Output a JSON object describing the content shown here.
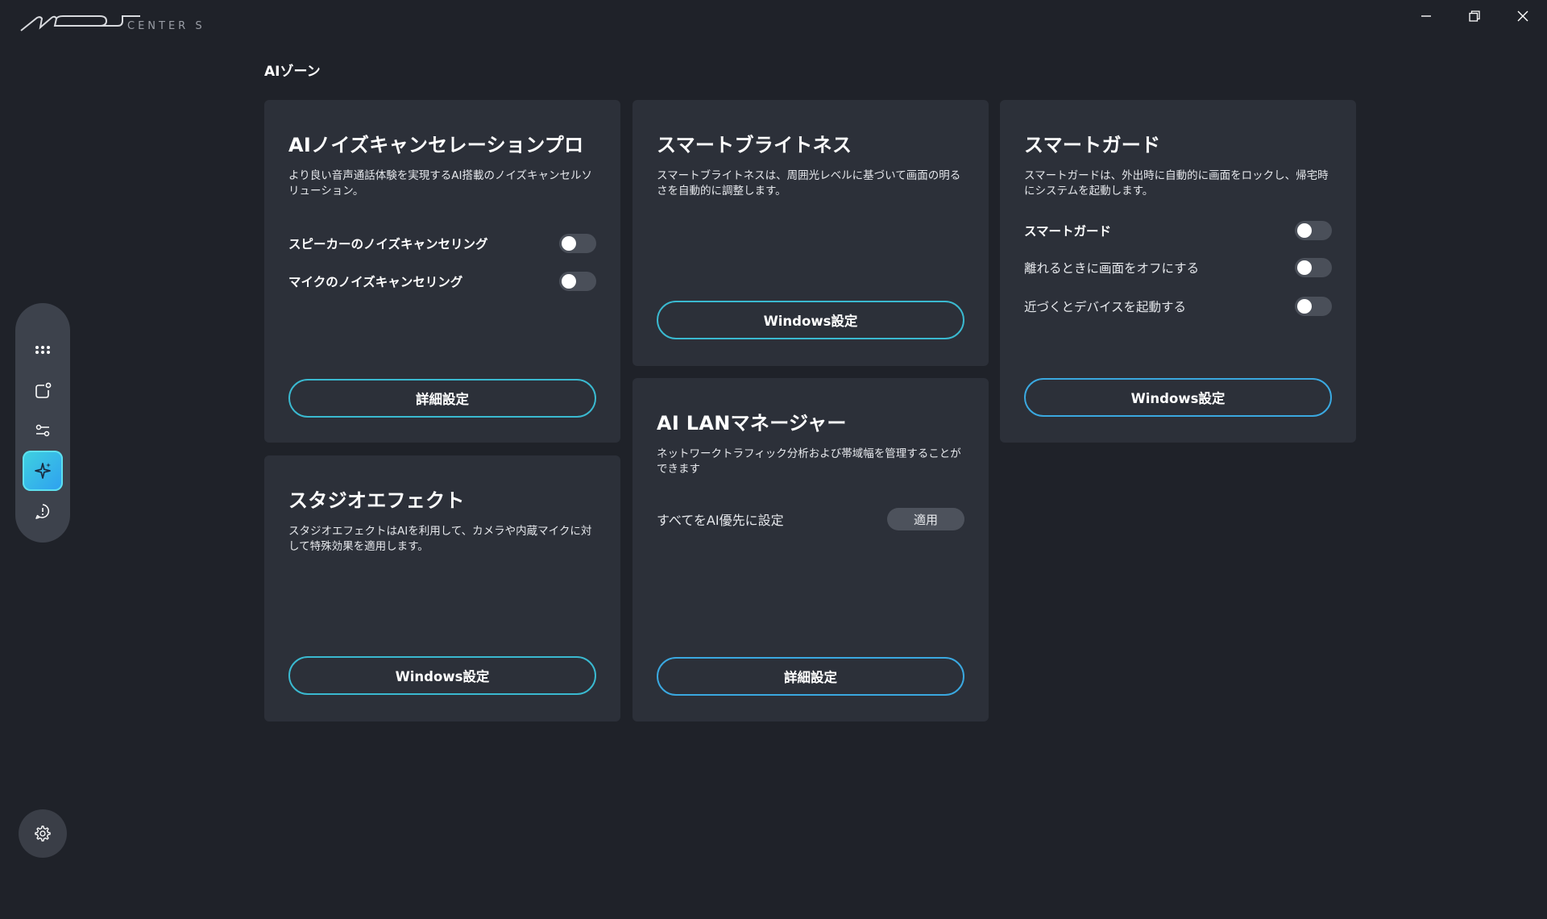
{
  "app": {
    "logo_text": "CENTER S"
  },
  "page": {
    "title": "AIゾーン"
  },
  "cards": {
    "noise": {
      "title": "AIノイズキャンセレーションプロ",
      "desc": "より良い音声通話体験を実現するAI搭載のノイズキャンセルソリューション。",
      "rows": [
        {
          "label": "スピーカーのノイズキャンセリング",
          "on": false
        },
        {
          "label": "マイクのノイズキャンセリング",
          "on": false
        }
      ],
      "button": "詳細設定"
    },
    "brightness": {
      "title": "スマートブライトネス",
      "desc": "スマートブライトネスは、周囲光レベルに基づいて画面の明るさを自動的に調整します。",
      "button": "Windows設定"
    },
    "guard": {
      "title": "スマートガード",
      "desc": "スマートガードは、外出時に自動的に画面をロックし、帰宅時にシステムを起動します。",
      "rows": [
        {
          "label": "スマートガード",
          "on": false
        },
        {
          "label": "離れるときに画面をオフにする",
          "on": false
        },
        {
          "label": "近づくとデバイスを起動する",
          "on": false
        }
      ],
      "button": "Windows設定"
    },
    "studio": {
      "title": "スタジオエフェクト",
      "desc": "スタジオエフェクトはAIを利用して、カメラや内蔵マイクに対して特殊効果を適用します。",
      "button": "Windows設定"
    },
    "lan": {
      "title": "AI LANマネージャー",
      "desc": "ネットワークトラフィック分析および帯域幅を管理することができます",
      "row_label": "すべてをAI優先に設定",
      "apply": "適用",
      "button": "詳細設定"
    }
  },
  "sidebar": {
    "items": [
      {
        "icon": "apps-grid-icon"
      },
      {
        "icon": "device-icon"
      },
      {
        "icon": "sliders-icon"
      },
      {
        "icon": "ai-sparkle-icon",
        "active": true
      },
      {
        "icon": "support-chat-icon"
      }
    ],
    "settings_icon": "gear-icon"
  },
  "colors": {
    "background": "#1f2229",
    "card": "#2c3039",
    "accent": "#3ab9d0",
    "active_gradient_start": "#3fd2e0",
    "active_gradient_end": "#2e9ff0"
  }
}
